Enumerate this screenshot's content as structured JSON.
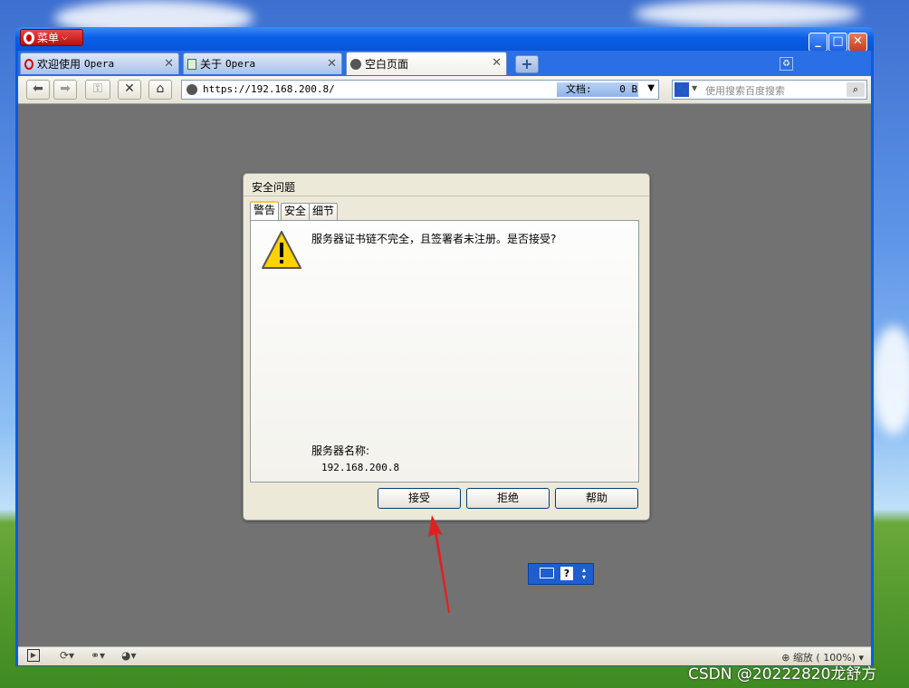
{
  "menu": {
    "label": "菜单"
  },
  "tabs": [
    {
      "label": "欢迎使用",
      "label2": "Opera",
      "icon": "opera-icon"
    },
    {
      "label": "关于",
      "label2": "Opera",
      "icon": "document-icon"
    },
    {
      "label": "空白页面",
      "icon": "globe-icon"
    }
  ],
  "address": {
    "url": "https://192.168.200.8/",
    "doc_label": "文档:",
    "doc_size": "0 B"
  },
  "search": {
    "placeholder": "使用搜索百度搜索"
  },
  "dialog": {
    "title": "安全问题",
    "tabs": [
      "警告",
      "安全",
      "细节"
    ],
    "message": "服务器证书链不完全，且签署者未注册。是否接受?",
    "server_label": "服务器名称:",
    "server_value": "192.168.200.8",
    "buttons": {
      "accept": "接受",
      "reject": "拒绝",
      "help": "帮助"
    }
  },
  "status": {
    "zoom": "缩放 ( 100%)"
  },
  "watermark": "CSDN @20222820龙舒方",
  "colors": {
    "accent_red": "#e02020",
    "xp_blue": "#0a5ee6",
    "warning_yellow": "#ffd200"
  }
}
